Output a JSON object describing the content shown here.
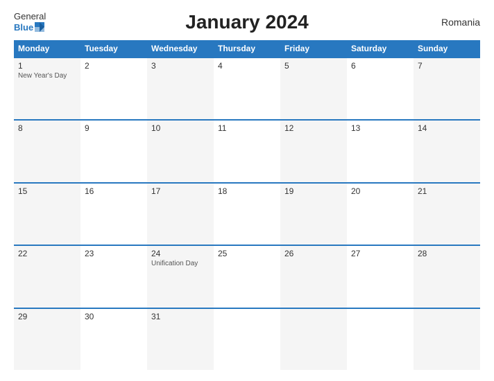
{
  "header": {
    "title": "January 2024",
    "country": "Romania",
    "logo_general": "General",
    "logo_blue": "Blue"
  },
  "days": {
    "headers": [
      "Monday",
      "Tuesday",
      "Wednesday",
      "Thursday",
      "Friday",
      "Saturday",
      "Sunday"
    ]
  },
  "weeks": [
    {
      "cells": [
        {
          "number": "1",
          "holiday": "New Year's Day"
        },
        {
          "number": "2",
          "holiday": ""
        },
        {
          "number": "3",
          "holiday": ""
        },
        {
          "number": "4",
          "holiday": ""
        },
        {
          "number": "5",
          "holiday": ""
        },
        {
          "number": "6",
          "holiday": ""
        },
        {
          "number": "7",
          "holiday": ""
        }
      ]
    },
    {
      "cells": [
        {
          "number": "8",
          "holiday": ""
        },
        {
          "number": "9",
          "holiday": ""
        },
        {
          "number": "10",
          "holiday": ""
        },
        {
          "number": "11",
          "holiday": ""
        },
        {
          "number": "12",
          "holiday": ""
        },
        {
          "number": "13",
          "holiday": ""
        },
        {
          "number": "14",
          "holiday": ""
        }
      ]
    },
    {
      "cells": [
        {
          "number": "15",
          "holiday": ""
        },
        {
          "number": "16",
          "holiday": ""
        },
        {
          "number": "17",
          "holiday": ""
        },
        {
          "number": "18",
          "holiday": ""
        },
        {
          "number": "19",
          "holiday": ""
        },
        {
          "number": "20",
          "holiday": ""
        },
        {
          "number": "21",
          "holiday": ""
        }
      ]
    },
    {
      "cells": [
        {
          "number": "22",
          "holiday": ""
        },
        {
          "number": "23",
          "holiday": ""
        },
        {
          "number": "24",
          "holiday": "Unification Day"
        },
        {
          "number": "25",
          "holiday": ""
        },
        {
          "number": "26",
          "holiday": ""
        },
        {
          "number": "27",
          "holiday": ""
        },
        {
          "number": "28",
          "holiday": ""
        }
      ]
    },
    {
      "cells": [
        {
          "number": "29",
          "holiday": ""
        },
        {
          "number": "30",
          "holiday": ""
        },
        {
          "number": "31",
          "holiday": ""
        },
        {
          "number": "",
          "holiday": ""
        },
        {
          "number": "",
          "holiday": ""
        },
        {
          "number": "",
          "holiday": ""
        },
        {
          "number": "",
          "holiday": ""
        }
      ]
    }
  ]
}
